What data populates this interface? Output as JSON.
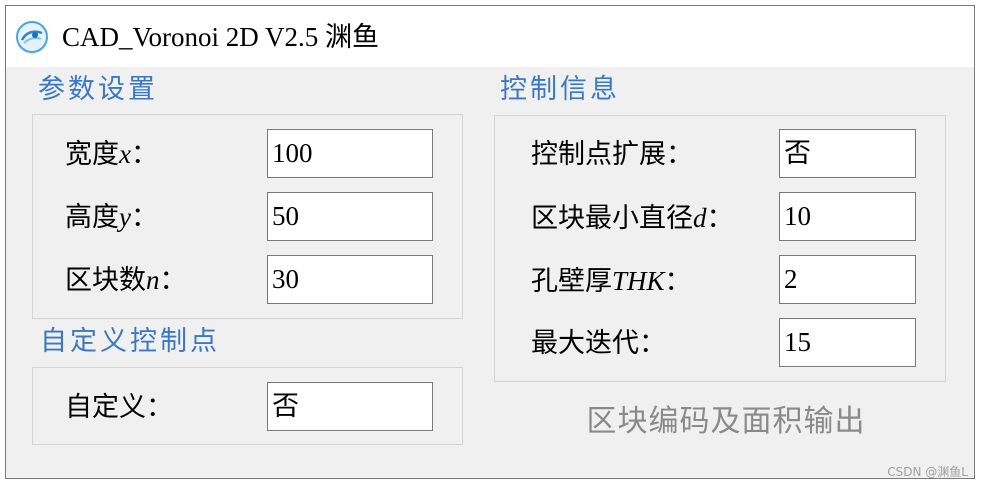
{
  "window": {
    "title": "CAD_Voronoi 2D V2.5 渊鱼",
    "icon": "app-logo-icon"
  },
  "params_group": {
    "title": "参数设置",
    "fields": [
      {
        "label_text": "宽度",
        "label_var": "x",
        "label_colon": "：",
        "value": "100"
      },
      {
        "label_text": "高度",
        "label_var": "y",
        "label_colon": "：",
        "value": "50"
      },
      {
        "label_text": "区块数",
        "label_var": "n",
        "label_colon": "：",
        "value": "30"
      }
    ]
  },
  "custom_group": {
    "title": "自定义控制点",
    "fields": [
      {
        "label_text": "自定义：",
        "value": "否"
      }
    ]
  },
  "control_group": {
    "title": "控制信息",
    "fields": [
      {
        "label_text": "控制点扩展：",
        "value": "否"
      },
      {
        "label_text": "区块最小直径",
        "label_var": "d",
        "label_colon": "：",
        "value": "10"
      },
      {
        "label_text": "孔壁厚",
        "label_var": "THK",
        "label_colon": "：",
        "value": "2"
      },
      {
        "label_text": "最大迭代：",
        "value": "15"
      }
    ]
  },
  "actions": {
    "output_label": "区块编码及面积输出"
  },
  "watermark": "CSDN @渊鱼L",
  "colors": {
    "group_title": "#3a78c4",
    "window_bg": "#f0f0f0",
    "output_text": "#8a8a8a"
  }
}
